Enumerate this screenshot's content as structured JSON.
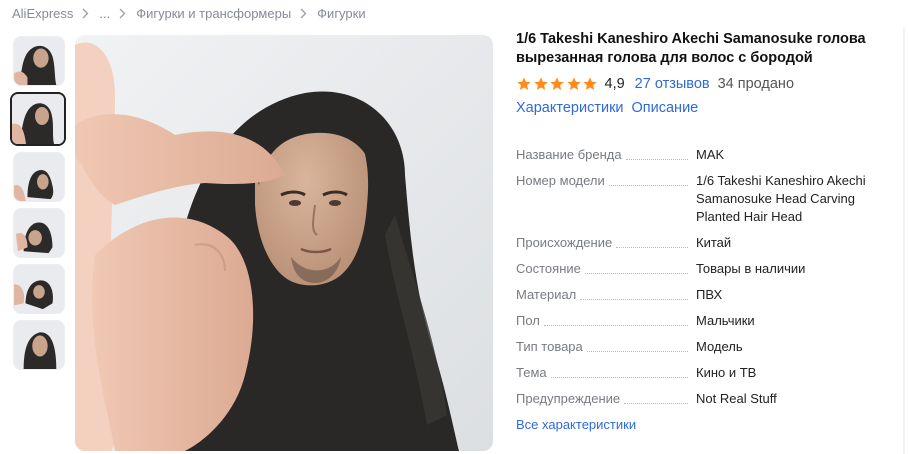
{
  "breadcrumb": {
    "items": [
      "AliExpress",
      "...",
      "Фигурки и трансформеры",
      "Фигурки"
    ]
  },
  "product": {
    "title": "1/6 Takeshi Kaneshiro Akechi Samanosuke голова вырезанная голова для волос с бородой",
    "rating": "4,9",
    "stars": 5,
    "reviews": "27 отзывов",
    "sold": "34 продано"
  },
  "tabs": [
    "Характеристики",
    "Описание"
  ],
  "specs": [
    {
      "key": "Название бренда",
      "value": "MAK"
    },
    {
      "key": "Номер модели",
      "value": "1/6 Takeshi Kaneshiro Akechi Samanosuke Head Carving Planted Hair Head"
    },
    {
      "key": "Происхождение",
      "value": "Китай"
    },
    {
      "key": "Состояние",
      "value": "Товары в наличии"
    },
    {
      "key": "Материал",
      "value": "ПВХ"
    },
    {
      "key": "Пол",
      "value": "Мальчики"
    },
    {
      "key": "Тип товара",
      "value": "Модель"
    },
    {
      "key": "Тема",
      "value": "Кино и ТВ"
    },
    {
      "key": "Предупреждение",
      "value": "Not Real Stuff"
    }
  ],
  "all_specs_link": "Все характеристики",
  "thumbnails": 6,
  "active_thumbnail": 2,
  "colors": {
    "link": "#2e6ad8",
    "star": "#ff8c1a",
    "muted": "#777b82"
  }
}
